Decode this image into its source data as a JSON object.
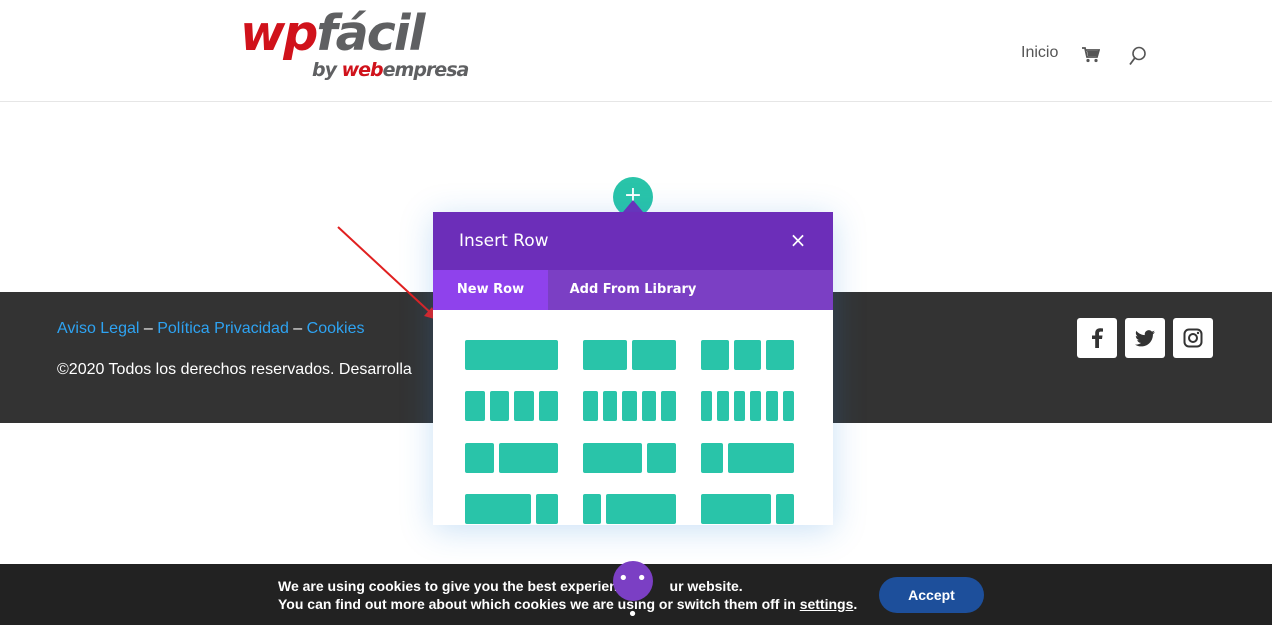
{
  "header": {
    "logo": {
      "wp": "wp",
      "facil": "fácil",
      "by": "by ",
      "web": "web",
      "empresa": "empresa"
    },
    "nav": {
      "home_label": "Inicio",
      "cart_icon": "cart-icon",
      "search_icon": "search-icon"
    }
  },
  "builder": {
    "add_button_label": "+",
    "modal": {
      "title": "Insert Row",
      "close_label": "×",
      "tabs": [
        {
          "label": "New Row",
          "active": true
        },
        {
          "label": "Add From Library",
          "active": false
        }
      ],
      "layouts": [
        [
          "1"
        ],
        [
          "1/2",
          "1/2"
        ],
        [
          "1/3",
          "1/3",
          "1/3"
        ],
        [
          "1/4",
          "1/4",
          "1/4",
          "1/4"
        ],
        [
          "1/5",
          "1/5",
          "1/5",
          "1/5",
          "1/5"
        ],
        [
          "1/6",
          "1/6",
          "1/6",
          "1/6",
          "1/6",
          "1/6"
        ],
        [
          "1/3",
          "2/3"
        ],
        [
          "2/3",
          "1/3"
        ],
        [
          "1/4",
          "3/4"
        ],
        [
          "3/4",
          "1/4"
        ],
        [
          "1/5",
          "4/5"
        ],
        [
          "4/5",
          "1/5"
        ]
      ],
      "colors": {
        "header": "#6c2eb9",
        "tabs": "#7b3fc4",
        "active_tab": "#8f42ec",
        "layout": "#29c4a9"
      }
    }
  },
  "footer": {
    "links": [
      {
        "label": "Aviso Legal"
      },
      {
        "label": "Política Privacidad"
      },
      {
        "label": "Cookies"
      }
    ],
    "separator": " – ",
    "copyright": "©2020 Todos los derechos reservados. Desarrolla",
    "social": [
      "facebook-icon",
      "twitter-icon",
      "instagram-icon"
    ]
  },
  "cookie_bar": {
    "line1": "We are using cookies to give you the best experienc",
    "line1_tail": "ur website.",
    "line2_pre": "You can find out more about which cookies we are using or switch them off in ",
    "settings_link": "settings",
    "line2_post": ".",
    "accept_label": "Accept",
    "more_label": "• • •"
  }
}
